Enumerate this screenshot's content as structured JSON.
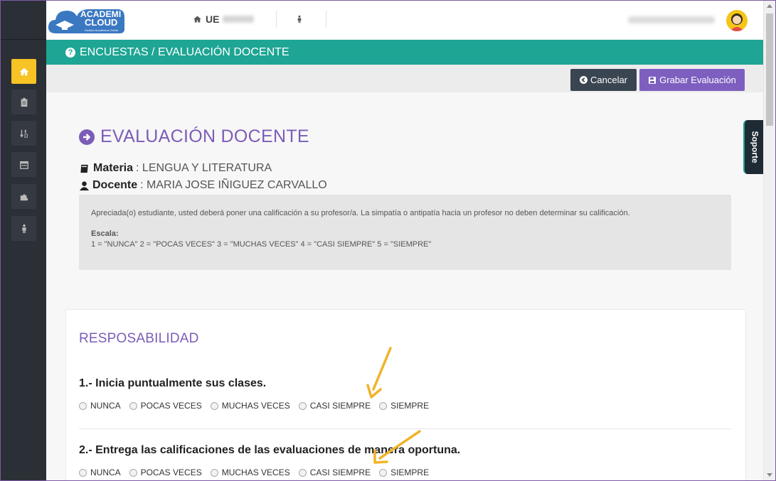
{
  "header": {
    "logo_line1": "ACADEMI",
    "logo_line2": "CLOUD",
    "logo_tagline": "Gestión Académica Online",
    "home_prefix": "UE"
  },
  "titlebar": {
    "text": "ENCUESTAS / EVALUACIÓN DOCENTE"
  },
  "toolbar": {
    "cancel_label": "Cancelar",
    "save_label": "Grabar Evaluación"
  },
  "page": {
    "heading": "EVALUACIÓN DOCENTE",
    "materia_label": "Materia",
    "materia_value": ": LENGUA Y LITERATURA",
    "docente_label": "Docente",
    "docente_value": ": MARIA JOSE IÑIGUEZ CARVALLO",
    "notice_text": "Apreciada(o) estudiante, usted deberá poner una calificación a su profesor/a. La simpatía o antipatía hacia un profesor no deben determinar su calificación.",
    "scale_title": "Escala:",
    "scale_text": "1 = \"NUNCA\" 2 = \"POCAS VECES\" 3 = \"MUCHAS VECES\" 4 = \"CASI SIEMPRE\" 5 = \"SIEMPRE\""
  },
  "survey": {
    "section_title": "RESPOSABILIDAD",
    "options": [
      "NUNCA",
      "POCAS VECES",
      "MUCHAS VECES",
      "CASI SIEMPRE",
      "SIEMPRE"
    ],
    "questions": [
      {
        "text": "1.- Inicia puntualmente sus clases."
      },
      {
        "text": "2.- Entrega las calificaciones de las evaluaciones de manera oportuna."
      }
    ]
  },
  "support_tab": {
    "label": "Soporte"
  },
  "colors": {
    "teal": "#1ea594",
    "purple": "#7b5db8",
    "sidebar": "#2b2f36",
    "active": "#f7c325",
    "annotation": "#f0b429"
  }
}
